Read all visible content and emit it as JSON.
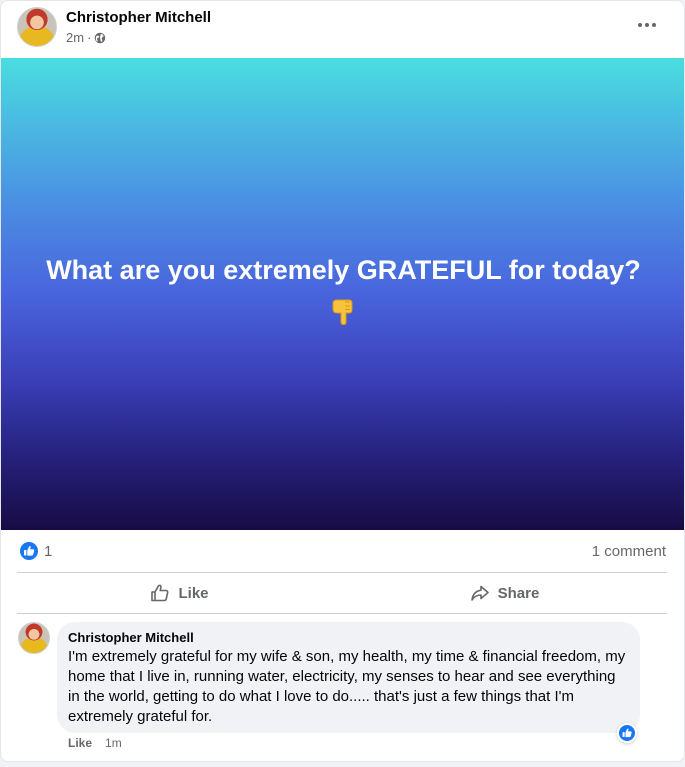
{
  "post": {
    "author": "Christopher Mitchell",
    "timestamp": "2m",
    "meta_separator": "·",
    "privacy_icon": "globe-icon",
    "more_icon": "more-dots-icon",
    "background_text": "What are you extremely GRATEFUL for today?",
    "background_emoji": "finger-pointing-down-emoji",
    "background_gradient": [
      "#49dde0",
      "#4964dd",
      "#180b45"
    ]
  },
  "summary": {
    "reaction_icon": "like-badge-icon",
    "reaction_count": "1",
    "comment_count": "1 comment"
  },
  "actions": {
    "like_label": "Like",
    "share_label": "Share"
  },
  "comment": {
    "author": "Christopher Mitchell",
    "text": "I'm extremely grateful for my wife & son, my health, my time & financial freedom, my home that I live in, running water, electricity, my senses to hear and see everything in the world, getting to do what I love to do..... that's just a few things that I'm extremely grateful for.",
    "like_label": "Like",
    "time": "1m",
    "reaction_icon": "like-badge-icon"
  },
  "colors": {
    "facebook_blue": "#1877f2",
    "secondary_text": "#65676b",
    "bubble_bg": "#f0f2f5"
  }
}
